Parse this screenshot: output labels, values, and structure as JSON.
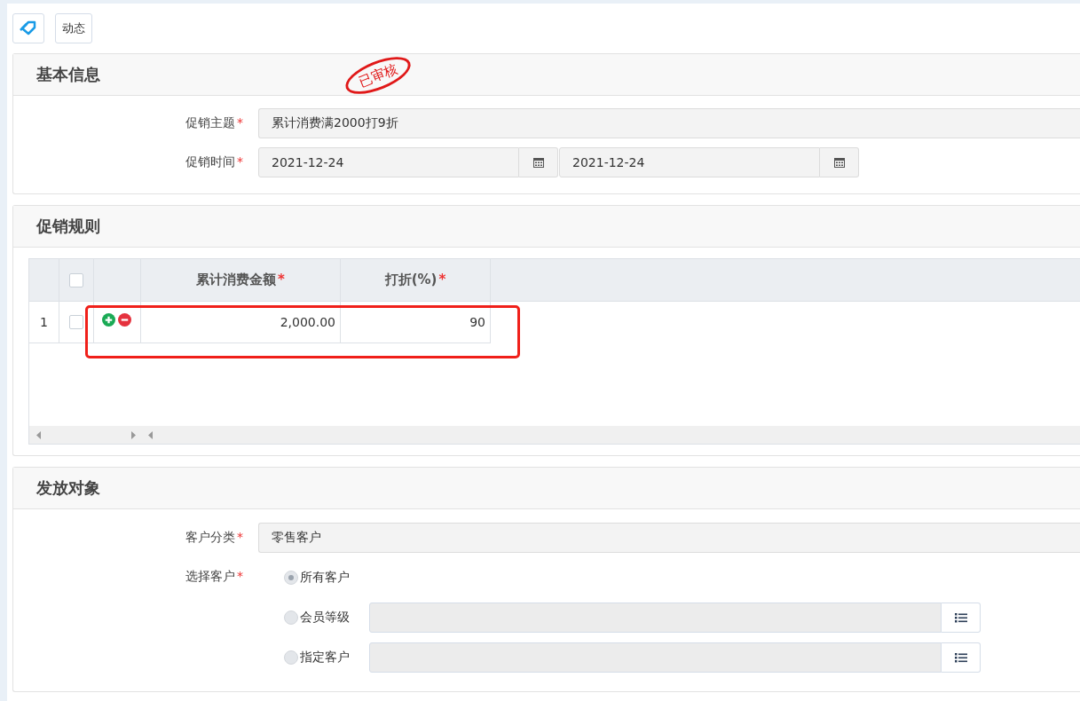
{
  "toolbar": {
    "buttons": [
      {
        "kind": "icon"
      },
      {
        "kind": "text",
        "label": "动态"
      }
    ]
  },
  "basic_info": {
    "title": "基本信息",
    "stamp": "已审核",
    "subject": {
      "label": "促销主题",
      "required_mark": "*",
      "value": "累计消费满2000打9折"
    },
    "period": {
      "label": "促销时间",
      "required_mark": "*",
      "start": "2021-12-24",
      "end": "2021-12-24"
    }
  },
  "rules": {
    "title": "促销规则",
    "columns": [
      {
        "label": "累计消费金额",
        "required_mark": "*"
      },
      {
        "label": "打折(%)",
        "required_mark": "*"
      }
    ],
    "header_checked": false,
    "rows": [
      {
        "index": "1",
        "checked": false,
        "amount": "2,000.00",
        "discount": "90",
        "highlighted": true
      }
    ]
  },
  "target": {
    "title": "发放对象",
    "category": {
      "label": "客户分类",
      "required_mark": "*",
      "value": "零售客户"
    },
    "choose": {
      "label": "选择客户",
      "required_mark": "*",
      "options": [
        {
          "label": "所有客户",
          "selected": true,
          "has_picker": false
        },
        {
          "label": "会员等级",
          "selected": false,
          "has_picker": true
        },
        {
          "label": "指定客户",
          "selected": false,
          "has_picker": true
        }
      ]
    }
  }
}
